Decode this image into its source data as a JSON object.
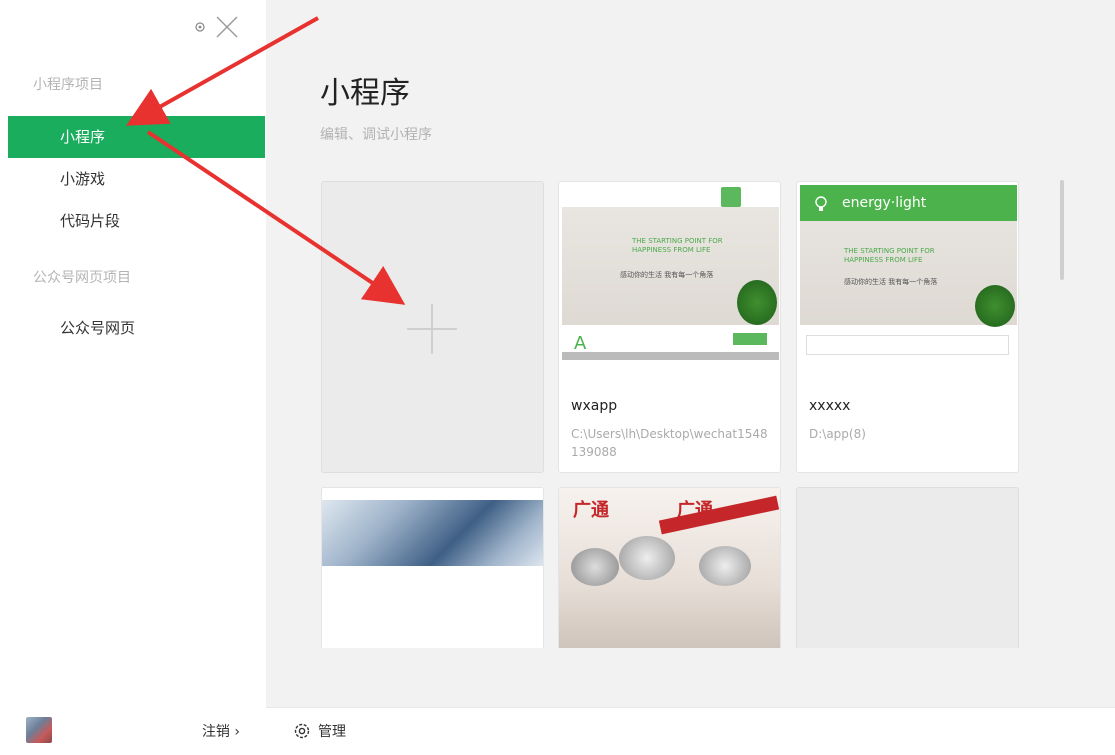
{
  "sidebar": {
    "section_miniprogram": "小程序项目",
    "items": [
      {
        "label": "小程序"
      },
      {
        "label": "小游戏"
      },
      {
        "label": "代码片段"
      }
    ],
    "section_official": "公众号网页项目",
    "official_items": [
      {
        "label": "公众号网页"
      }
    ],
    "logout_label": "注销 ›"
  },
  "main": {
    "title": "小程序",
    "subtitle": "编辑、调试小程序",
    "projects": [
      {
        "name": "wxapp",
        "path": "C:\\Users\\lh\\Desktop\\wechat1548139088",
        "thumb_text": "THE STARTING POINT FOR HAPPINESS FROM LIFE",
        "thumb_cn": "感动你的生活 我有每一个角落"
      },
      {
        "name": "xxxxx",
        "path": "D:\\app(8)",
        "thumb_title": "energy·light",
        "thumb_text": "THE STARTING POINT FOR HAPPINESS FROM LIFE",
        "thumb_cn": "感动你的生活 我有每一个角落"
      }
    ],
    "second_row_brand": "广通"
  },
  "footer": {
    "manage_label": "管理"
  },
  "colors": {
    "accent": "#1aad5d",
    "arrow": "#e8322f"
  }
}
